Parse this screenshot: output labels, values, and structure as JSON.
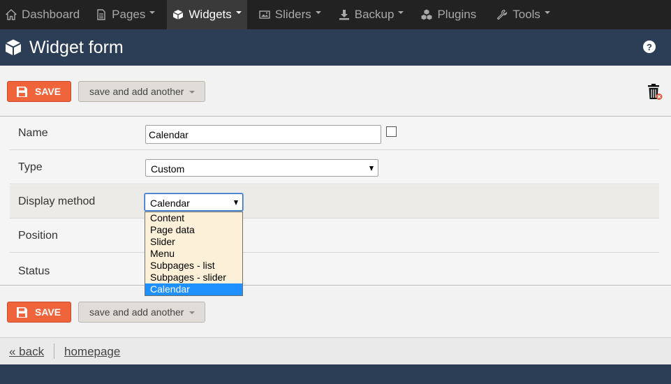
{
  "nav": {
    "items": [
      {
        "label": "Dashboard",
        "icon": "home-icon",
        "caret": false,
        "active": false
      },
      {
        "label": "Pages",
        "icon": "page-icon",
        "caret": true,
        "active": false
      },
      {
        "label": "Widgets",
        "icon": "cube-icon",
        "caret": true,
        "active": true
      },
      {
        "label": "Sliders",
        "icon": "image-icon",
        "caret": true,
        "active": false
      },
      {
        "label": "Backup",
        "icon": "download-icon",
        "caret": true,
        "active": false
      },
      {
        "label": "Plugins",
        "icon": "cubes-icon",
        "caret": false,
        "active": false
      },
      {
        "label": "Tools",
        "icon": "wrench-icon",
        "caret": true,
        "active": false
      }
    ]
  },
  "header": {
    "title": "Widget form",
    "help_label": "?"
  },
  "toolbar": {
    "save_label": "SAVE",
    "save_another_label": "save and add another"
  },
  "form": {
    "name_label": "Name",
    "name_value": "Calendar",
    "type_label": "Type",
    "type_value": "Custom",
    "display_label": "Display method",
    "display_value": "Calendar",
    "position_label": "Position",
    "status_label": "Status",
    "display_options": [
      "Content",
      "Page data",
      "Slider",
      "Menu",
      "Subpages - list",
      "Subpages - slider",
      "Calendar"
    ],
    "display_selected_index": 6
  },
  "footer": {
    "back_label": "« back",
    "homepage_label": "homepage"
  },
  "colors": {
    "save_button": "#f0643c",
    "header_bg": "#2c3e55",
    "nav_bg": "#222222",
    "option_highlight": "#1e90ff",
    "dropdown_bg": "#fdf0d8"
  }
}
